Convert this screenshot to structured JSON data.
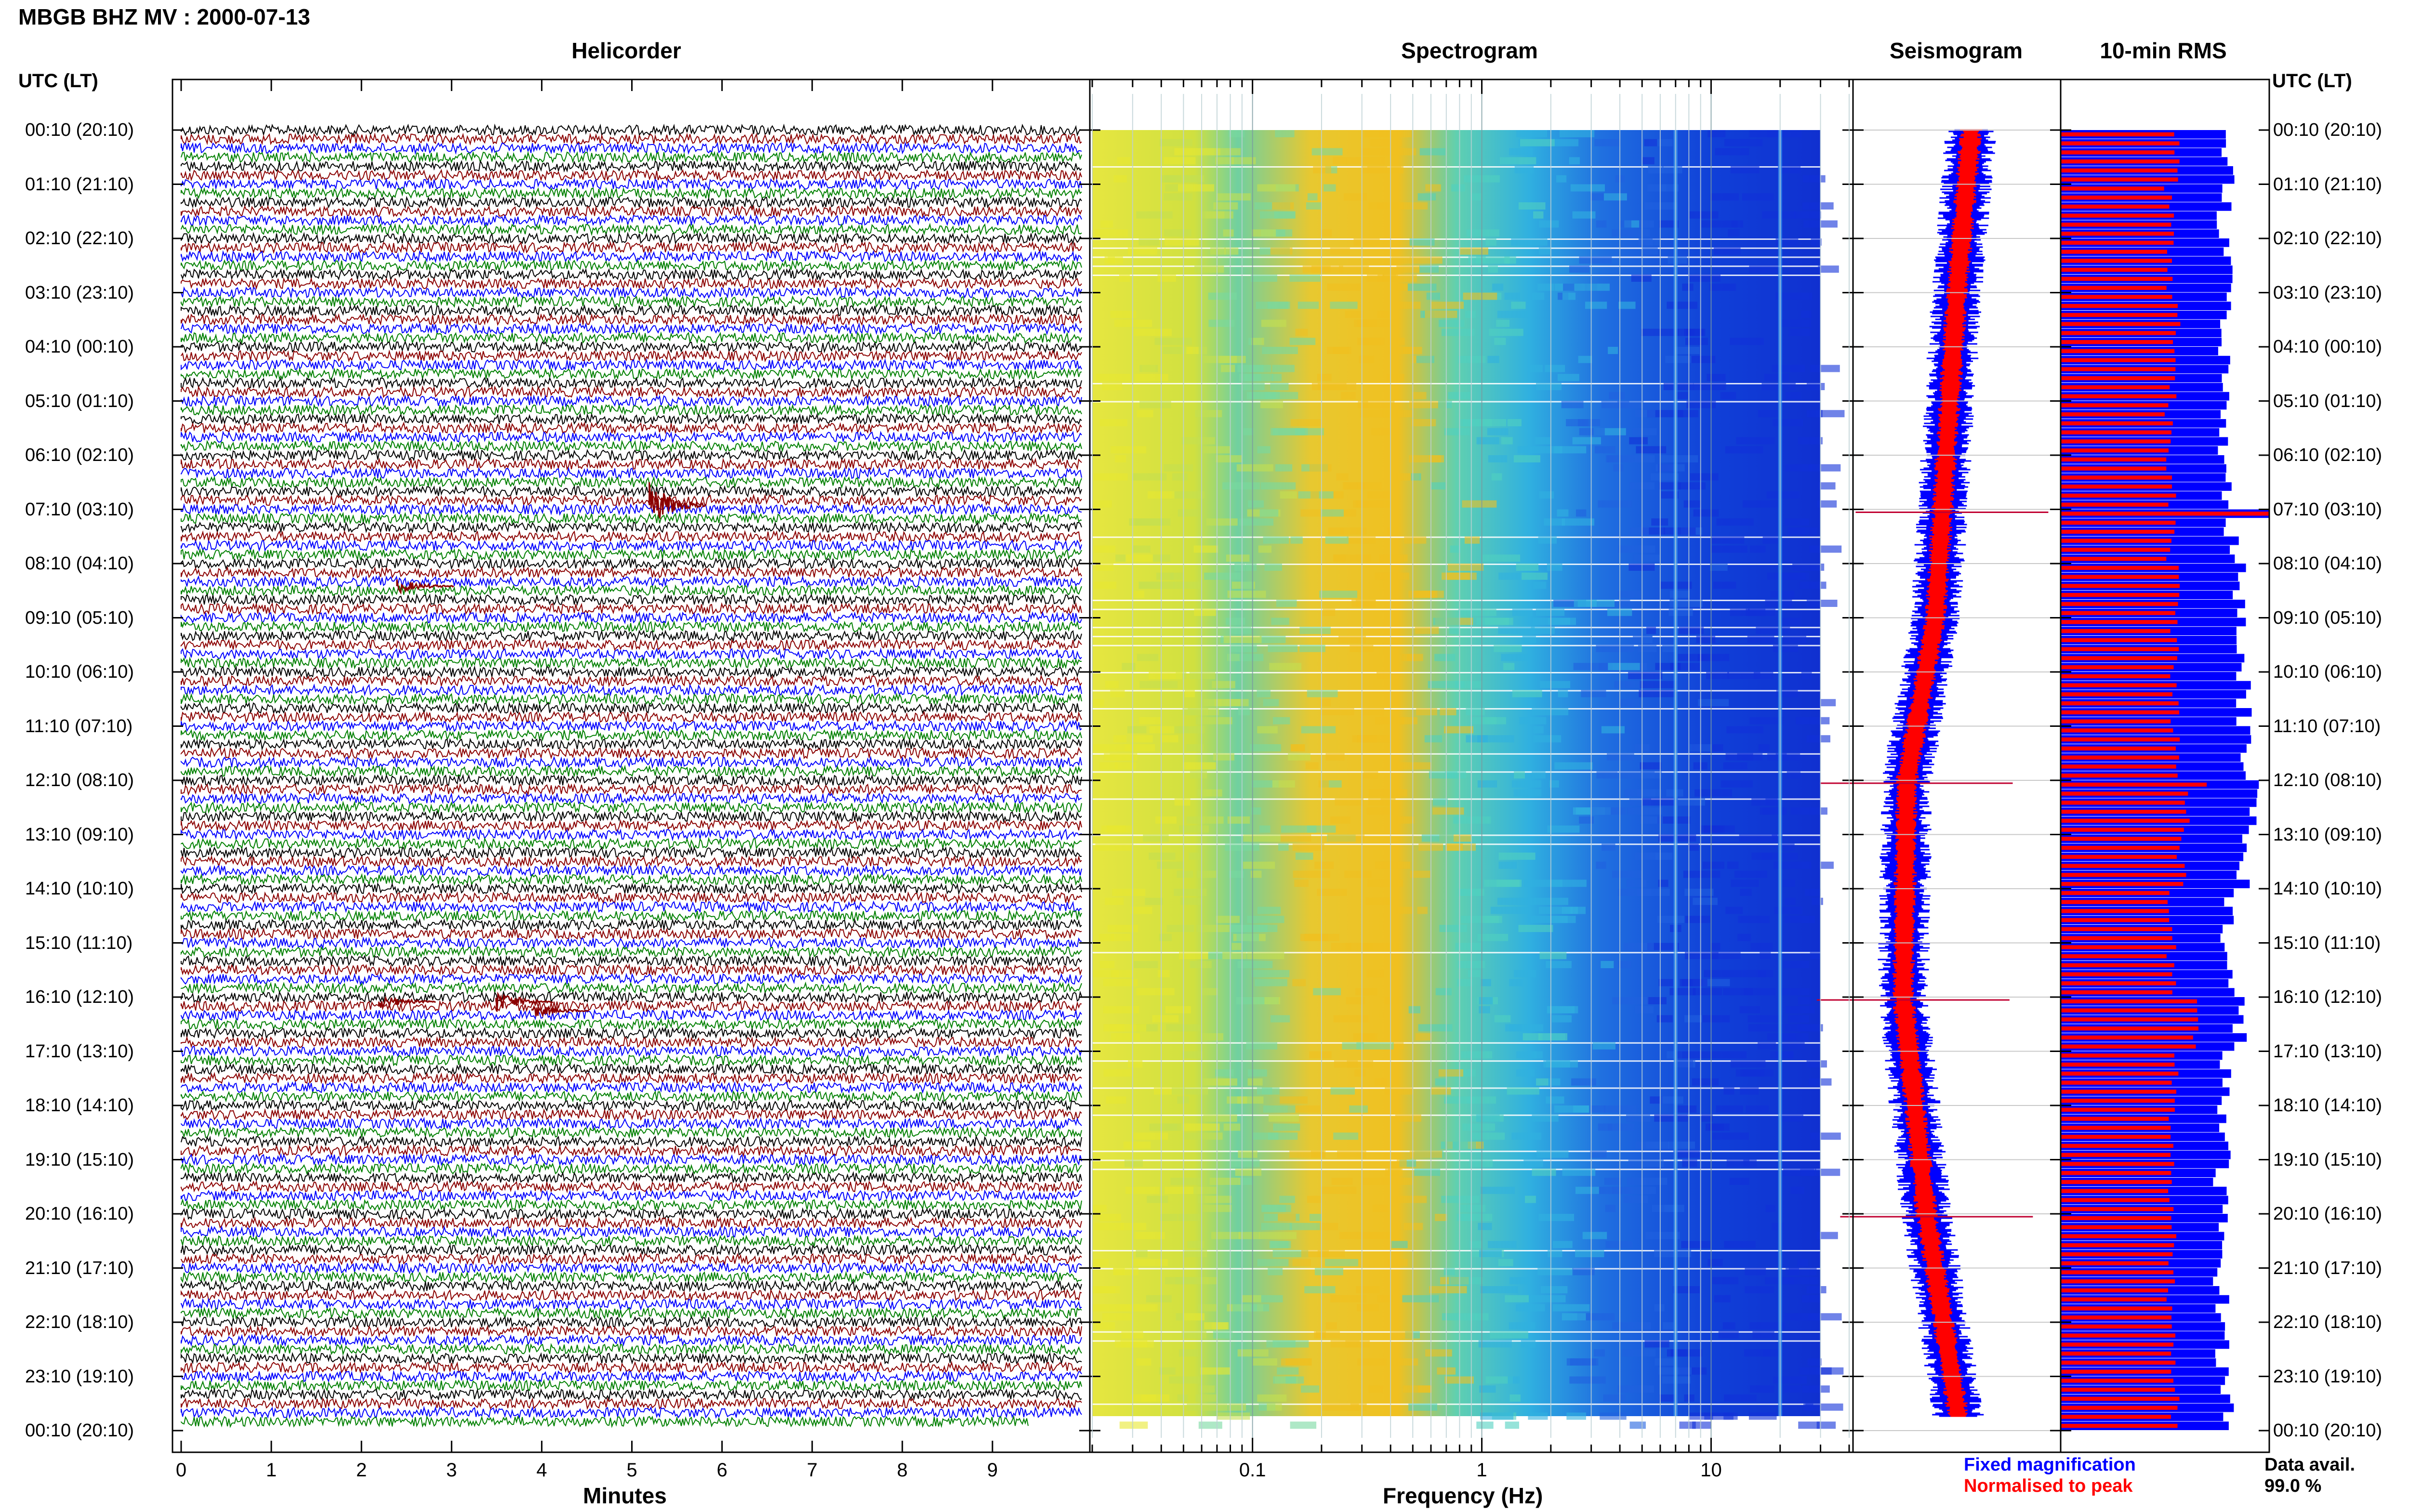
{
  "title": "MBGB BHZ MV : 2000-07-13",
  "panels": {
    "helicorder": "Helicorder",
    "spectrogram": "Spectrogram",
    "seismogram": "Seismogram",
    "rms": "10-min RMS"
  },
  "utc_header": "UTC (LT)",
  "time_labels": [
    "00:10 (20:10)",
    "01:10 (21:10)",
    "02:10 (22:10)",
    "03:10 (23:10)",
    "04:10 (00:10)",
    "05:10 (01:10)",
    "06:10 (02:10)",
    "07:10 (03:10)",
    "08:10 (04:10)",
    "09:10 (05:10)",
    "10:10 (06:10)",
    "11:10 (07:10)",
    "12:10 (08:10)",
    "13:10 (09:10)",
    "14:10 (10:10)",
    "15:10 (11:10)",
    "16:10 (12:10)",
    "17:10 (13:10)",
    "18:10 (14:10)",
    "19:10 (15:10)",
    "20:10 (16:10)",
    "21:10 (17:10)",
    "22:10 (18:10)",
    "23:10 (19:10)",
    "00:10 (20:10)"
  ],
  "helicorder_axis": {
    "label": "Minutes",
    "ticks": [
      "0",
      "1",
      "2",
      "3",
      "4",
      "5",
      "6",
      "7",
      "8",
      "9"
    ]
  },
  "spectrogram_axis": {
    "label": "Frequency (Hz)",
    "ticks": [
      "0.1",
      "1",
      "10"
    ]
  },
  "legend": {
    "fixed": "Fixed magnification",
    "normalised": "Normalised to peak"
  },
  "data_avail": {
    "label": "Data avail.",
    "value": "99.0 %"
  },
  "colors": {
    "fixed": "#0000ff",
    "normalised": "#ff0000",
    "trace_cycle": [
      "#000000",
      "#8b0000",
      "#0000ff",
      "#008000"
    ]
  },
  "chart_data": [
    {
      "type": "line",
      "title": "Helicorder",
      "xlabel": "Minutes",
      "xlim": [
        0,
        10
      ],
      "rows": 144,
      "row_minutes": 10,
      "events": [
        {
          "time_utc": "07:00",
          "minute": 5.3,
          "relative_amplitude": 6
        },
        {
          "time_utc": "08:30",
          "minute": 2.5,
          "relative_amplitude": 2
        },
        {
          "time_utc": "16:10",
          "minute": 2.3,
          "relative_amplitude": 2
        },
        {
          "time_utc": "16:10",
          "minute": 3.6,
          "relative_amplitude": 3
        },
        {
          "time_utc": "16:20",
          "minute": 4.0,
          "relative_amplitude": 2
        }
      ]
    },
    {
      "type": "heatmap",
      "title": "Spectrogram",
      "xlabel": "Frequency (Hz)",
      "xscale": "log",
      "xlim": [
        0.02,
        40
      ],
      "rows": 144,
      "energy_peak_hz": [
        0.2,
        0.6
      ],
      "narrow_bands_hz": [
        7,
        20
      ]
    },
    {
      "type": "line",
      "title": "Seismogram",
      "series": [
        {
          "name": "Fixed magnification",
          "color": "#0000ff"
        },
        {
          "name": "Normalised to peak",
          "color": "#ff0000"
        }
      ],
      "center_trace_relative": [
        0.58,
        0.5,
        0.44,
        0.38,
        0.22,
        0.2,
        0.33,
        0.52
      ],
      "center_trace_hours": [
        0,
        3,
        6,
        9,
        12,
        16,
        20,
        24
      ],
      "spikes_utc": [
        "07:10",
        "12:10",
        "16:10",
        "20:10"
      ]
    },
    {
      "type": "bar",
      "title": "10-min RMS",
      "series": [
        {
          "name": "Fixed magnification",
          "color": "#0000ff"
        },
        {
          "name": "Normalised to peak",
          "color": "#ff0000"
        }
      ],
      "rms_hours": [
        0,
        1,
        2,
        3,
        4,
        5,
        6,
        7,
        8,
        9,
        10,
        11,
        12,
        13,
        14,
        15,
        16,
        17,
        18,
        19,
        20,
        21,
        22,
        23
      ],
      "rms_fixed_relative": [
        0.8,
        0.78,
        0.79,
        0.8,
        0.78,
        0.79,
        0.8,
        0.82,
        0.86,
        0.88,
        0.88,
        0.88,
        0.92,
        0.88,
        0.8,
        0.8,
        0.86,
        0.78,
        0.78,
        0.77,
        0.77,
        0.77,
        0.78,
        0.8
      ],
      "rms_normalised_relative": [
        0.55,
        0.52,
        0.53,
        0.55,
        0.53,
        0.52,
        0.53,
        0.53,
        0.55,
        0.55,
        0.55,
        0.55,
        0.6,
        0.58,
        0.53,
        0.53,
        0.65,
        0.55,
        0.53,
        0.53,
        0.53,
        0.53,
        0.53,
        0.55
      ],
      "rms_peaks": [
        {
          "time_utc": "07:10",
          "fixed": 1.0,
          "normalised": 1.0
        },
        {
          "time_utc": "12:10",
          "fixed": 0.95,
          "normalised": 0.7
        }
      ]
    }
  ]
}
